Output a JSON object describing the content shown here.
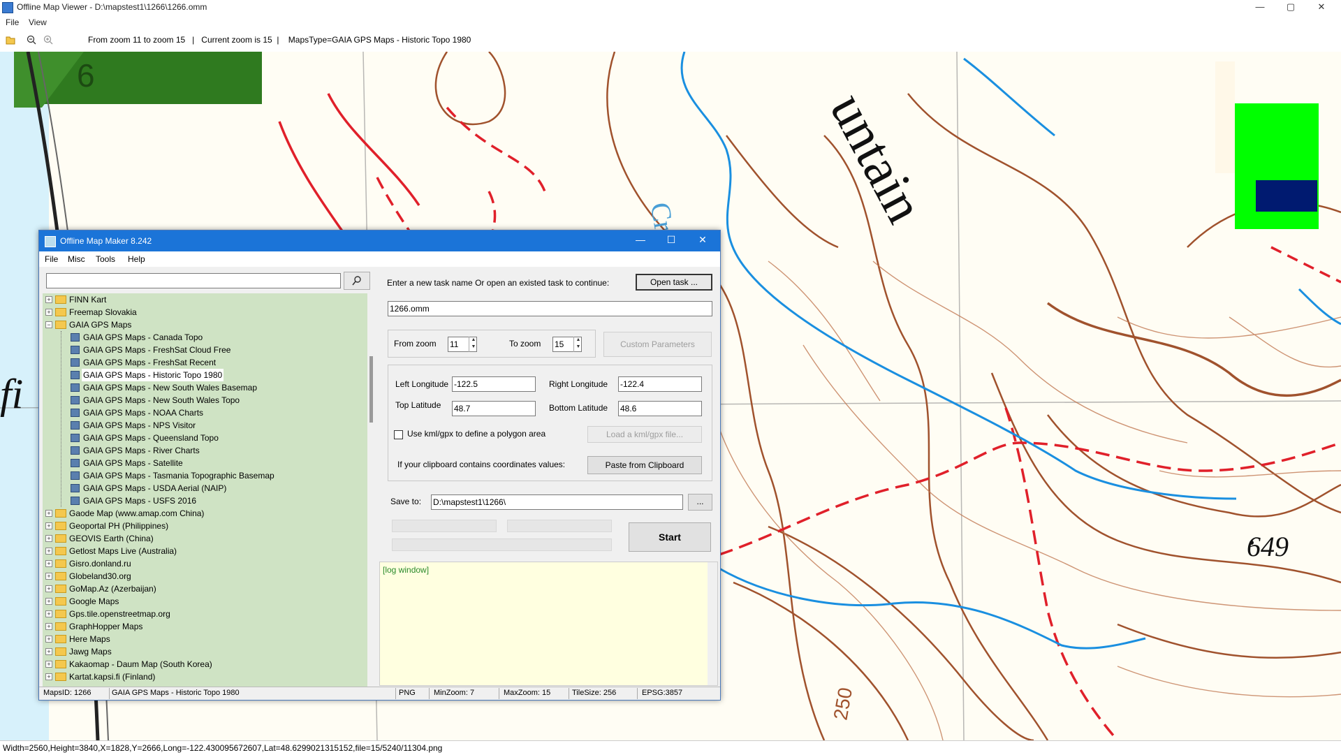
{
  "window": {
    "title": "Offline Map Viewer - D:\\mapstest1\\1266\\1266.omm",
    "menu": [
      "File",
      "View"
    ],
    "toolbar_info": "From zoom 11 to zoom 15   |   Current zoom is 15  |    MapsType=GAIA GPS Maps - Historic Topo 1980",
    "status": "Width=2560,Height=3840,X=1828,Y=2666,Long=-122.430095672607,Lat=48.6299021315152,file=15/5240/11304.png",
    "controls": {
      "minimize": "—",
      "maximize": "▢",
      "close": "✕"
    }
  },
  "map": {
    "labels": {
      "mountain_fragment": "untain",
      "elevation": "649",
      "contour": "250",
      "left_fragment": "fi",
      "creek_fragment": "Cre",
      "number": "6"
    },
    "colors": {
      "contour": "#a0522d",
      "road": "#e0202a",
      "water": "#1a8fe0",
      "paper": "#fffdf4",
      "woods": "#2f7a1f",
      "sea": "#cfeefa"
    }
  },
  "dialog": {
    "title": "Offline Map Maker 8.242",
    "menu": [
      "File",
      "Misc",
      "Tools",
      "Help"
    ],
    "search_value": "",
    "tree": [
      {
        "label": "FINN Kart",
        "type": "folder",
        "expanded": false,
        "level": 0
      },
      {
        "label": "Freemap Slovakia",
        "type": "folder",
        "expanded": false,
        "level": 0
      },
      {
        "label": "GAIA GPS Maps",
        "type": "folder",
        "expanded": true,
        "level": 0
      },
      {
        "label": "GAIA GPS Maps - Canada Topo",
        "type": "map",
        "level": 1
      },
      {
        "label": "GAIA GPS Maps - FreshSat Cloud Free",
        "type": "map",
        "level": 1
      },
      {
        "label": "GAIA GPS Maps - FreshSat Recent",
        "type": "map",
        "level": 1
      },
      {
        "label": "GAIA GPS Maps - Historic Topo 1980",
        "type": "map",
        "level": 1,
        "selected": true
      },
      {
        "label": "GAIA GPS Maps - New South Wales Basemap",
        "type": "map",
        "level": 1
      },
      {
        "label": "GAIA GPS Maps - New South Wales Topo",
        "type": "map",
        "level": 1
      },
      {
        "label": "GAIA GPS Maps - NOAA Charts",
        "type": "map",
        "level": 1
      },
      {
        "label": "GAIA GPS Maps - NPS Visitor",
        "type": "map",
        "level": 1
      },
      {
        "label": "GAIA GPS Maps - Queensland Topo",
        "type": "map",
        "level": 1
      },
      {
        "label": "GAIA GPS Maps - River Charts",
        "type": "map",
        "level": 1
      },
      {
        "label": "GAIA GPS Maps - Satellite",
        "type": "map",
        "level": 1
      },
      {
        "label": "GAIA GPS Maps - Tasmania Topographic Basemap",
        "type": "map",
        "level": 1
      },
      {
        "label": "GAIA GPS Maps - USDA Aerial (NAIP)",
        "type": "map",
        "level": 1
      },
      {
        "label": "GAIA GPS Maps - USFS 2016",
        "type": "map",
        "level": 1
      },
      {
        "label": "Gaode Map (www.amap.com China)",
        "type": "folder",
        "expanded": false,
        "level": 0
      },
      {
        "label": "Geoportal PH (Philippines)",
        "type": "folder",
        "expanded": false,
        "level": 0
      },
      {
        "label": "GEOVIS Earth (China)",
        "type": "folder",
        "expanded": false,
        "level": 0
      },
      {
        "label": "Getlost Maps Live (Australia)",
        "type": "folder",
        "expanded": false,
        "level": 0
      },
      {
        "label": "Gisro.donland.ru",
        "type": "folder",
        "expanded": false,
        "level": 0
      },
      {
        "label": "Globeland30.org",
        "type": "folder",
        "expanded": false,
        "level": 0
      },
      {
        "label": "GoMap.Az (Azerbaijan)",
        "type": "folder",
        "expanded": false,
        "level": 0
      },
      {
        "label": "Google Maps",
        "type": "folder",
        "expanded": false,
        "level": 0
      },
      {
        "label": "Gps.tile.openstreetmap.org",
        "type": "folder",
        "expanded": false,
        "level": 0
      },
      {
        "label": "GraphHopper Maps",
        "type": "folder",
        "expanded": false,
        "level": 0
      },
      {
        "label": "Here Maps",
        "type": "folder",
        "expanded": false,
        "level": 0
      },
      {
        "label": "Jawg Maps",
        "type": "folder",
        "expanded": false,
        "level": 0
      },
      {
        "label": "Kakaomap - Daum Map (South Korea)",
        "type": "folder",
        "expanded": false,
        "level": 0
      },
      {
        "label": "Kartat.kapsi.fi (Finland)",
        "type": "folder",
        "expanded": false,
        "level": 0
      }
    ],
    "task_prompt": "Enter a new task name Or open an existed task to continue:",
    "open_task": "Open task ...",
    "task_name": "1266.omm",
    "from_zoom_label": "From zoom",
    "from_zoom": "11",
    "to_zoom_label": "To zoom",
    "to_zoom": "15",
    "custom_params": "Custom Parameters",
    "left_lon_label": "Left Longitude",
    "left_lon": "-122.5",
    "right_lon_label": "Right Longitude",
    "right_lon": "-122.4",
    "top_lat_label": "Top Latitude",
    "top_lat": "48.7",
    "bottom_lat_label": "Bottom Latitude",
    "bottom_lat": "48.6",
    "kml_label": "Use kml/gpx to define a polygon area",
    "kml_checked": false,
    "load_kml": "Load a kml/gpx file...",
    "clipboard_label": "If your clipboard contains coordinates values:",
    "paste_clipboard": "Paste from Clipboard",
    "save_to_label": "Save to:",
    "save_to": "D:\\mapstest1\\1266\\",
    "browse": "...",
    "start": "Start",
    "log_text": "[log window]",
    "status": {
      "maps_id": "MapsID: 1266",
      "map_name": "GAIA GPS Maps - Historic Topo 1980",
      "format": "PNG",
      "min_zoom": "MinZoom: 7",
      "max_zoom": "MaxZoom: 15",
      "tile_size": "TileSize: 256",
      "epsg": "EPSG:3857"
    },
    "controls": {
      "minimize": "—",
      "maximize": "☐",
      "close": "✕"
    }
  }
}
